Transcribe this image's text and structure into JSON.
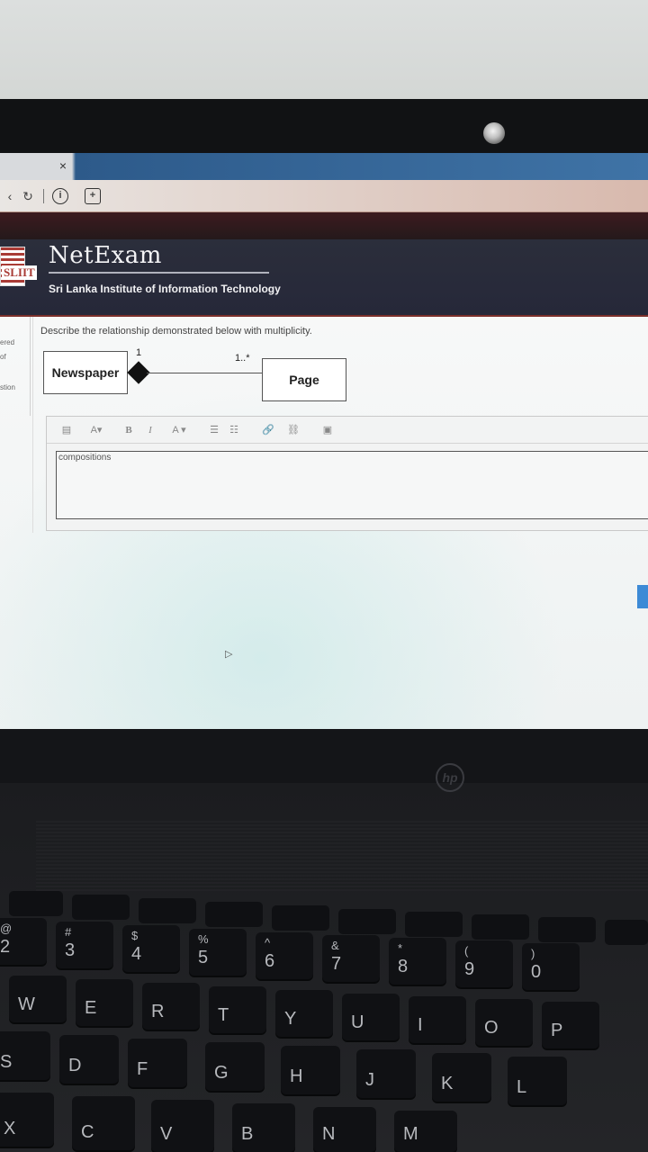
{
  "browser": {
    "tab_close": "×",
    "back": "‹",
    "reload": "↻",
    "info": "i",
    "ext": "+"
  },
  "header": {
    "logo_text": "SLIIT",
    "brand": "NetExam",
    "subtitle": "Sri Lanka Institute of Information Technology"
  },
  "left_nav": {
    "items": [
      "ered",
      "of",
      "stion"
    ]
  },
  "question": {
    "text": "Describe the relationship demonstrated below with multiplicity.",
    "diagram": {
      "left_class": "Newspaper",
      "right_class": "Page",
      "left_multiplicity": "1",
      "right_multiplicity": "1..*"
    }
  },
  "editor": {
    "toolbar": {
      "format": "▤",
      "text_color": "A▾",
      "bold": "B",
      "italic": "I",
      "font_size": "A ▾",
      "bullets": "☰",
      "numbers": "☷",
      "link": "🔗",
      "unlink": "⛓",
      "image": "▣"
    },
    "answer": "compositions"
  },
  "laptop": {
    "brand": "hp",
    "keys_num": [
      {
        "main": "2",
        "top": "@"
      },
      {
        "main": "3",
        "top": "#"
      },
      {
        "main": "4",
        "top": "$"
      },
      {
        "main": "5",
        "top": "%"
      },
      {
        "main": "6",
        "top": "^"
      },
      {
        "main": "7",
        "top": "&"
      },
      {
        "main": "8",
        "top": "*"
      },
      {
        "main": "9",
        "top": "("
      },
      {
        "main": "0",
        "top": ")"
      }
    ],
    "keys_row1": [
      "W",
      "E",
      "R",
      "T",
      "Y",
      "U",
      "I",
      "O",
      "P"
    ],
    "keys_row2": [
      "S",
      "D",
      "F",
      "G",
      "H",
      "J",
      "K",
      "L"
    ],
    "keys_row3": [
      "X",
      "C",
      "V",
      "B",
      "N",
      "M"
    ]
  }
}
